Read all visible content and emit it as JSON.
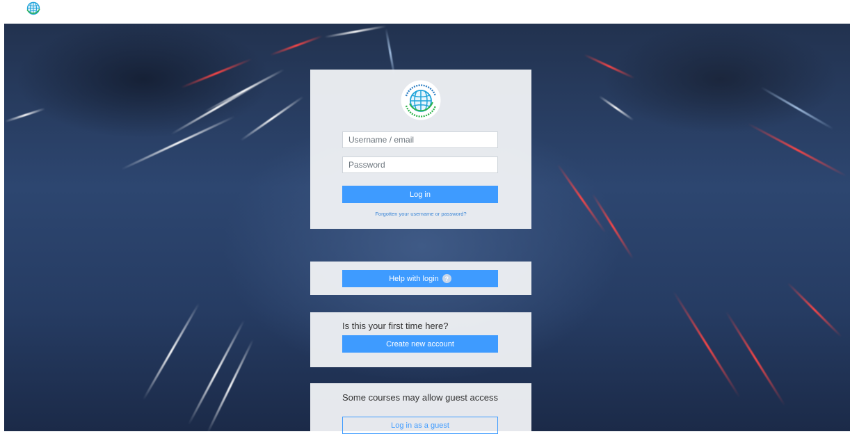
{
  "icons": {
    "site_logo": "globe-icon",
    "help": "question-icon"
  },
  "colors": {
    "primary": "#3e9bff",
    "panel": "#eef0f4",
    "text": "#333333",
    "link": "#3b86d6"
  },
  "login": {
    "username_placeholder": "Username / email",
    "password_placeholder": "Password",
    "login_button": "Log in",
    "forgot_link": "Forgotten your username or password?"
  },
  "help": {
    "button": "Help with login",
    "icon_glyph": "?"
  },
  "signup": {
    "heading": "Is this your first time here?",
    "button": "Create new account"
  },
  "guest": {
    "text": "Some courses may allow guest access",
    "button": "Log in as a guest"
  }
}
